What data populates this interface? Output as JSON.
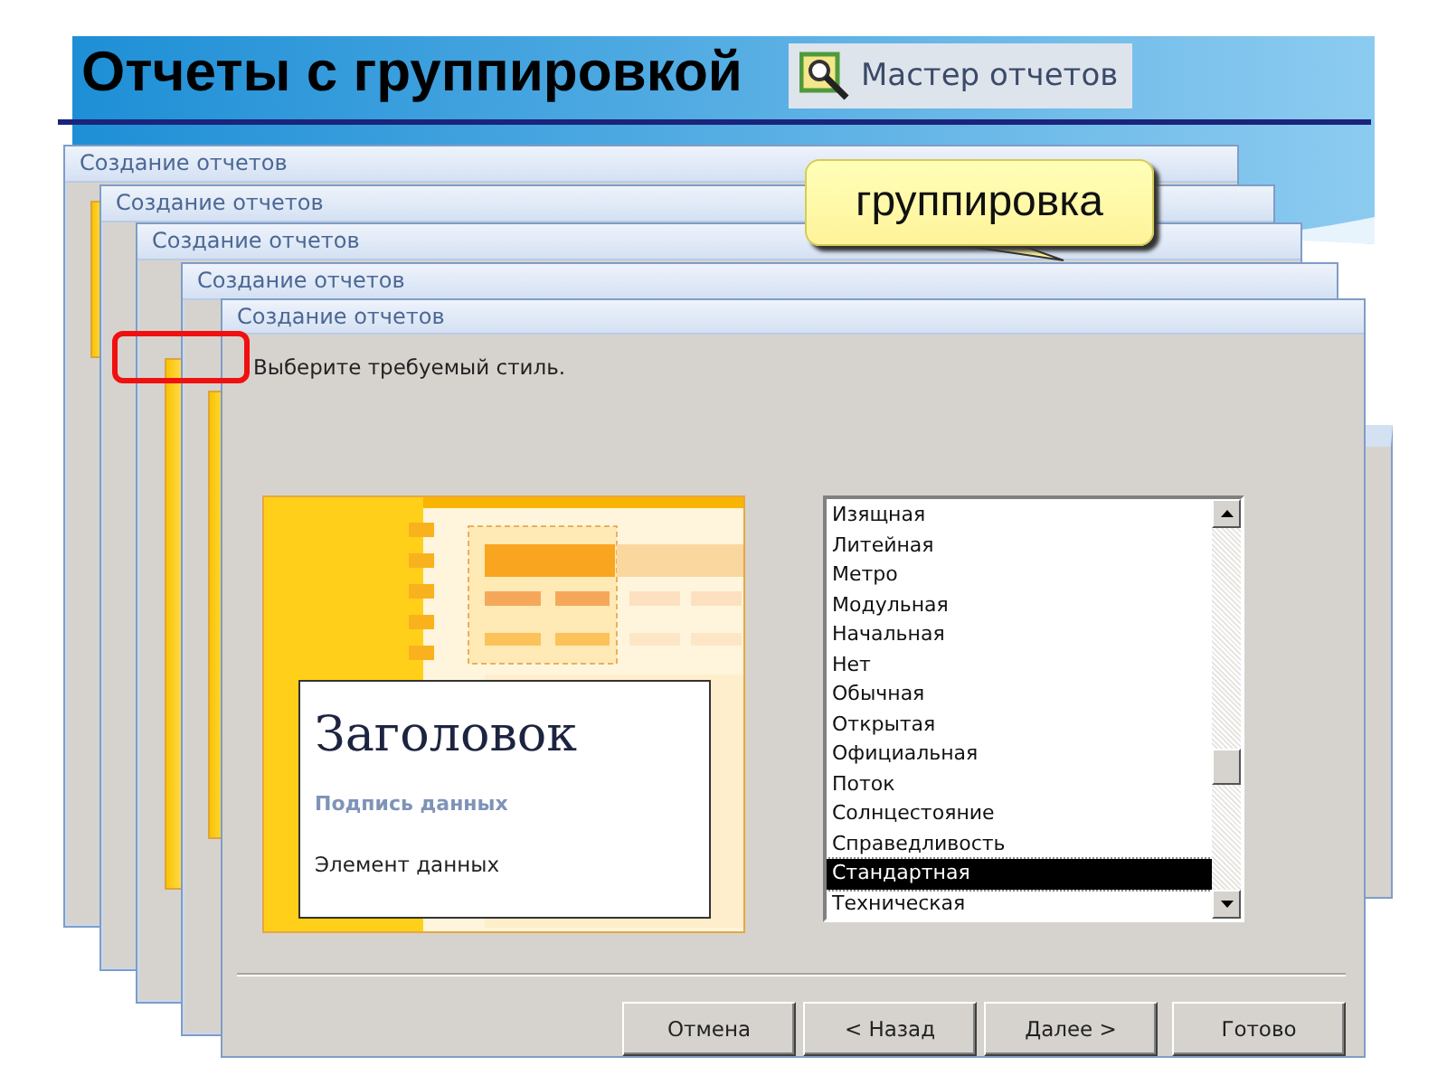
{
  "slide": {
    "title": "Отчеты с группировкой",
    "ribbon_button": {
      "label": "Мастер отчетов"
    }
  },
  "callout": {
    "text": "группировка"
  },
  "background_windows": [
    {
      "title": "Создание отчетов"
    },
    {
      "title": "Создание отчетов"
    },
    {
      "title": "Создание отчетов"
    },
    {
      "title": "Создание отчетов"
    }
  ],
  "dialog": {
    "title": "Создание отчетов",
    "prompt": "Выберите требуемый стиль.",
    "preview": {
      "heading": "Заголовок",
      "caption": "Подпись данных",
      "item": "Элемент данных"
    },
    "styles": [
      {
        "label": "Изящная",
        "selected": false
      },
      {
        "label": "Литейная",
        "selected": false
      },
      {
        "label": "Метро",
        "selected": false
      },
      {
        "label": "Модульная",
        "selected": false
      },
      {
        "label": "Начальная",
        "selected": false
      },
      {
        "label": "Нет",
        "selected": false
      },
      {
        "label": "Обычная",
        "selected": false
      },
      {
        "label": "Открытая",
        "selected": false
      },
      {
        "label": "Официальная",
        "selected": false
      },
      {
        "label": "Поток",
        "selected": false
      },
      {
        "label": "Солнцестояние",
        "selected": false
      },
      {
        "label": "Справедливость",
        "selected": false
      },
      {
        "label": "Стандартная",
        "selected": true
      },
      {
        "label": "Техническая",
        "selected": false
      }
    ],
    "buttons": [
      {
        "label": "Отмена"
      },
      {
        "label": "< Назад"
      },
      {
        "label": "Далее >"
      },
      {
        "label": "Готово"
      }
    ]
  }
}
